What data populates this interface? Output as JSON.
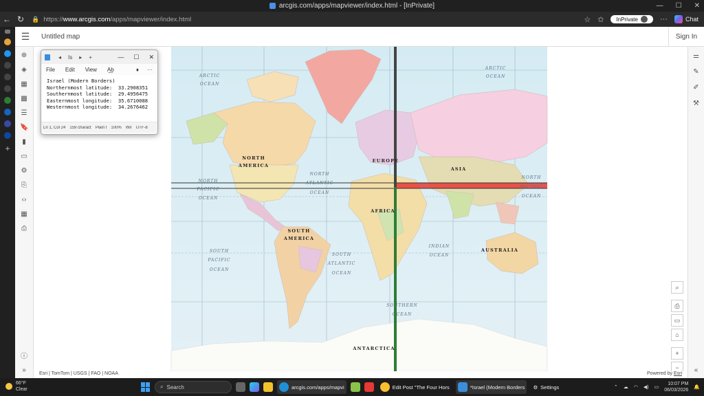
{
  "browser": {
    "window_title": "arcgis.com/apps/mapviewer/index.html - [InPrivate]",
    "url_prefix": "https://",
    "url_host": "www.arcgis.com",
    "url_path": "/apps/mapviewer/index.html",
    "inprivate_label": "InPrivate",
    "chat_label": "Chat"
  },
  "app": {
    "map_title": "Untitled map",
    "sign_in": "Sign In",
    "attribution": "Esri | TomTom | USGS | FAO | NOAA",
    "powered_by": "Powered by ",
    "powered_by_link": "Esri"
  },
  "map_labels": {
    "arctic_ocean_left": [
      "ARCTIC",
      "OCEAN"
    ],
    "arctic_ocean_right": [
      "ARCTIC",
      "OCEAN"
    ],
    "north_america": [
      "NORTH",
      "AMERICA"
    ],
    "europe": "EUROPE",
    "asia": "ASIA",
    "north_pacific_left": [
      "NORTH",
      "PACIFIC",
      "OCEAN"
    ],
    "north_pacific_right": [
      "NORTH",
      "PACIFIC",
      "OCEAN"
    ],
    "north_atlantic": [
      "NORTH",
      "ATLANTIC",
      "OCEAN"
    ],
    "africa": "AFRICA",
    "south_america": [
      "SOUTH",
      "AMERICA"
    ],
    "south_pacific": [
      "SOUTH",
      "PACIFIC",
      "OCEAN"
    ],
    "south_atlantic": [
      "SOUTH",
      "ATLANTIC",
      "OCEAN"
    ],
    "indian_ocean": [
      "INDIAN",
      "OCEAN"
    ],
    "australia": "AUSTRALIA",
    "southern_ocean": [
      "SOUTHERN",
      "OCEAN"
    ],
    "antarctica": "ANTARCTICA"
  },
  "notepad": {
    "tab_label": "Is",
    "menu": [
      "File",
      "Edit",
      "View"
    ],
    "text_lines": [
      "Israel (Modern Borders)",
      "Northernmost latitude:  33.2908351",
      "Southernmost latitude:  29.4956475",
      "Easternmost longitude:  35.6710088",
      "Westernmost longitude:  34.2676462"
    ],
    "status": [
      "Ln 1, Col 24",
      "159 charact",
      "Plain t",
      "100%",
      "Wir",
      "UTF-8"
    ]
  },
  "taskbar": {
    "weather_temp": "66°F",
    "weather_desc": "Clear",
    "search_placeholder": "Search",
    "items": [
      "arcgis.com/apps/mapvi",
      "Edit Post \"The Four Hors",
      "*Israel (Modern Borders",
      "Settings"
    ],
    "time": "10:07 PM",
    "date": "06/03/2026"
  },
  "colors": {
    "ocean": "#d8ecf3",
    "highlight_band": "#e53935",
    "meridian_line": "#2e7d32",
    "vertical_line_top": "#333333"
  }
}
